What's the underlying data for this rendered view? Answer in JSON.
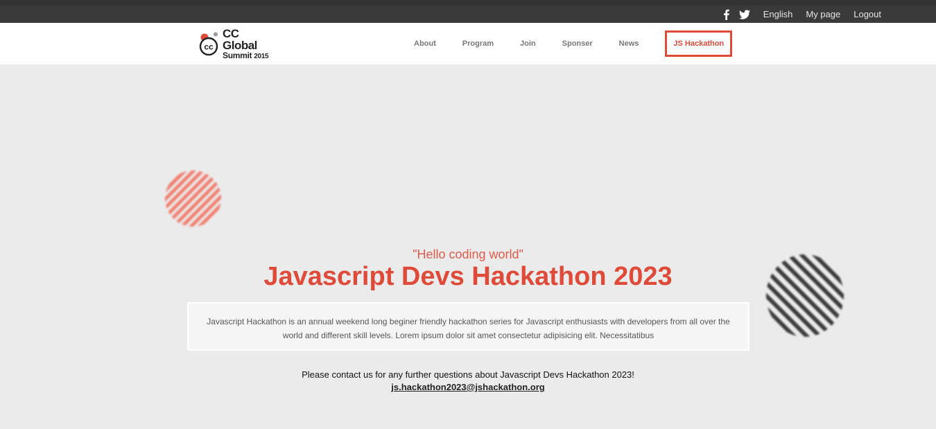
{
  "topbar": {
    "social": [
      "facebook-icon",
      "twitter-icon"
    ],
    "links": [
      "English",
      "My page",
      "Logout"
    ]
  },
  "header": {
    "logo": {
      "line1": "CC Global",
      "line2": "Summit",
      "year": "2015"
    },
    "nav": [
      "About",
      "Program",
      "Join",
      "Sponser",
      "News",
      "JS Hackathon"
    ],
    "active_nav": "JS Hackathon"
  },
  "hero": {
    "quote": "\"Hello coding world\"",
    "title": "Javascript Devs Hackathon 2023",
    "description": "Javascript Hackathon is an annual weekend long beginer friendly hackathon series for Javascript enthusiasts with developers from all over the world and different skill levels. Lorem ipsum dolor sit amet consectetur adipisicing elit. Necessitatibus",
    "contact_text": "Please contact us for any further questions about Javascript Devs Hackathon 2023!",
    "contact_email": "js.hackathon2023@jshackathon.org"
  },
  "colors": {
    "accent": "#e04b39",
    "topbar": "#3a3a3a",
    "background": "#ebebeb"
  }
}
